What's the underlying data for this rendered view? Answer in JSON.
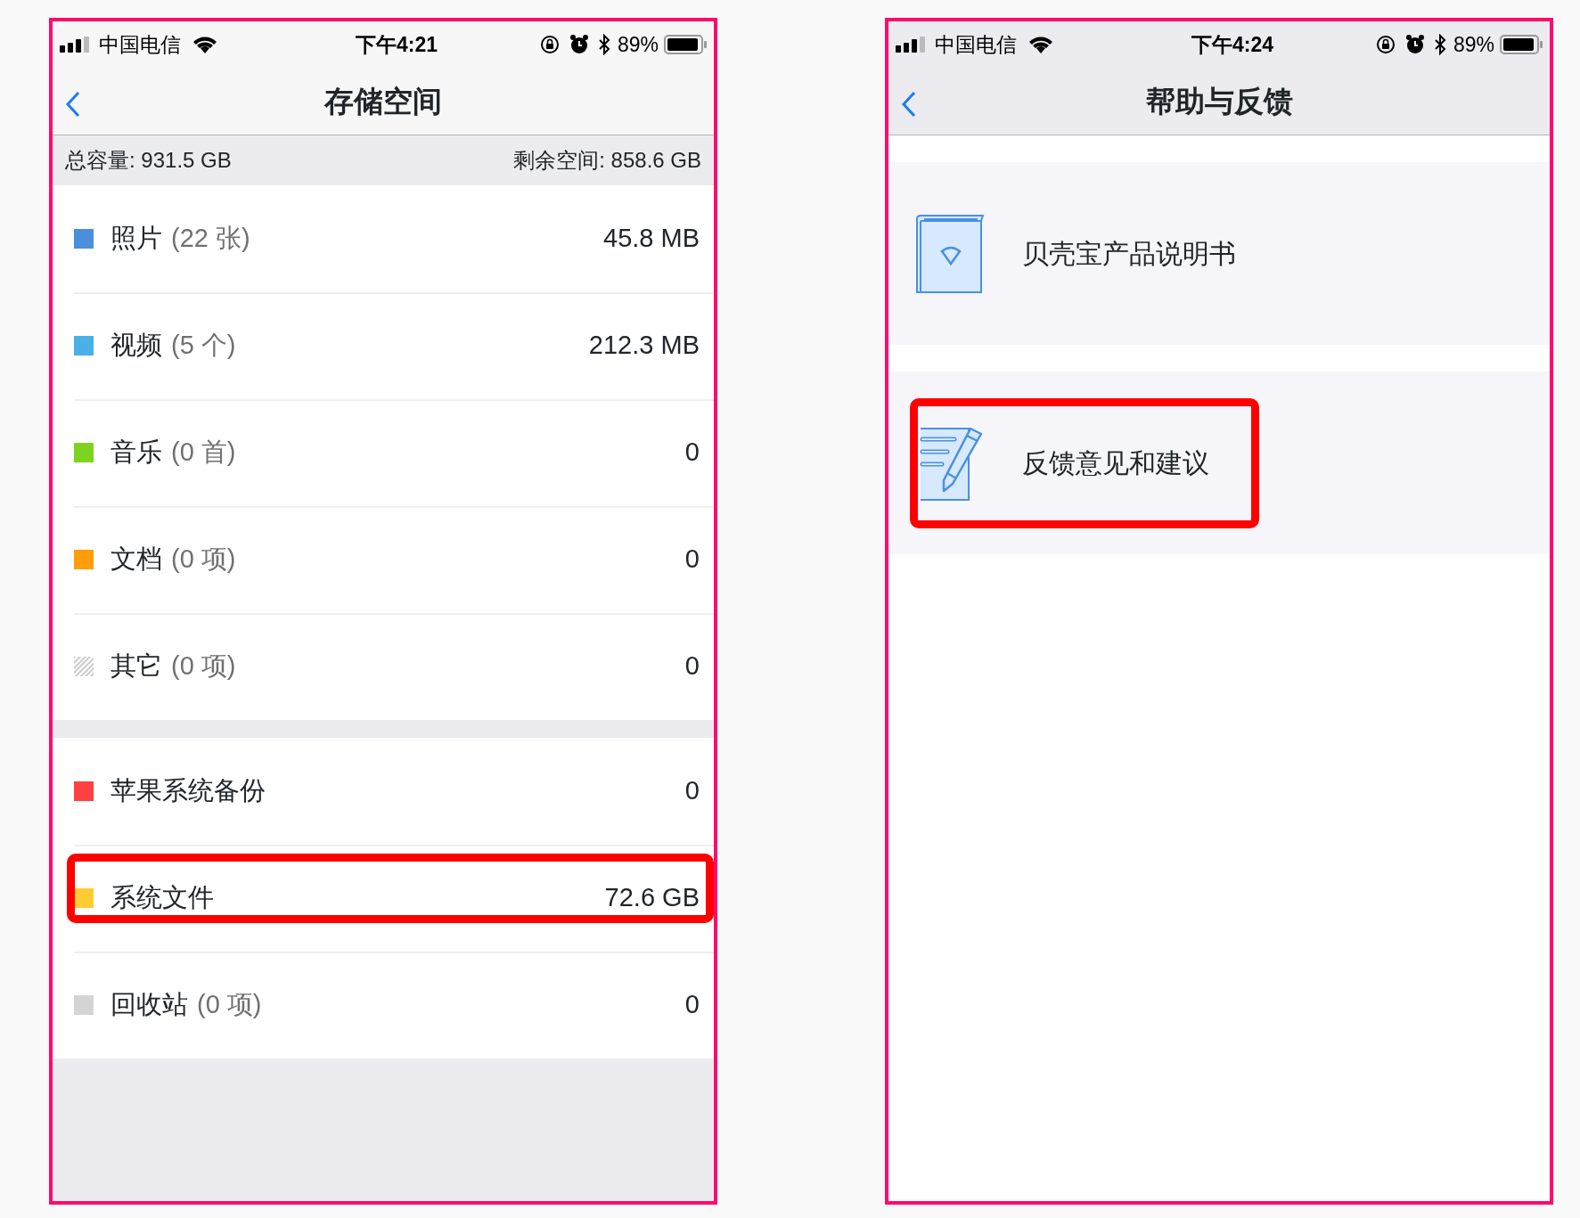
{
  "storage_screen": {
    "status_bar": {
      "carrier": "中国电信",
      "time": "下午4:21",
      "battery": "89%"
    },
    "nav": {
      "title": "存储空间"
    },
    "summary": {
      "total": "总容量: 931.5 GB",
      "free": "剩余空间: 858.6 GB"
    },
    "sections": [
      {
        "items": [
          {
            "name": "照片",
            "count": "(22 张)",
            "size": "45.8 MB",
            "color": "#4a8fdc",
            "kind": "solid",
            "highlighted": false
          },
          {
            "name": "视频",
            "count": "(5 个)",
            "size": "212.3 MB",
            "color": "#4ab0e8",
            "kind": "solid",
            "highlighted": false
          },
          {
            "name": "音乐",
            "count": "(0 首)",
            "size": "0",
            "color": "#7ed321",
            "kind": "solid",
            "highlighted": false
          },
          {
            "name": "文档",
            "count": "(0 项)",
            "size": "0",
            "color": "#ff9d0a",
            "kind": "solid",
            "highlighted": false
          },
          {
            "name": "其它",
            "count": "(0 项)",
            "size": "0",
            "color": "#cfcfcf",
            "kind": "hatched",
            "highlighted": false
          }
        ]
      },
      {
        "items": [
          {
            "name": "苹果系统备份",
            "size": "0",
            "color": "#ff4040",
            "kind": "solid",
            "highlighted": false
          },
          {
            "name": "系统文件",
            "size": "72.6 GB",
            "color": "#ffcc33",
            "kind": "solid",
            "highlighted": true
          },
          {
            "name": "回收站",
            "count": "(0 项)",
            "size": "0",
            "color": "#d4d4d4",
            "kind": "solid",
            "highlighted": false
          }
        ]
      }
    ]
  },
  "help_screen": {
    "status_bar": {
      "carrier": "中国电信",
      "time": "下午4:24",
      "battery": "89%"
    },
    "nav": {
      "title": "帮助与反馈"
    },
    "menu": [
      {
        "label": "贝壳宝产品说明书",
        "kind": "book",
        "highlighted": false
      },
      {
        "label": "反馈意见和建议",
        "kind": "edit",
        "highlighted": true
      }
    ]
  }
}
